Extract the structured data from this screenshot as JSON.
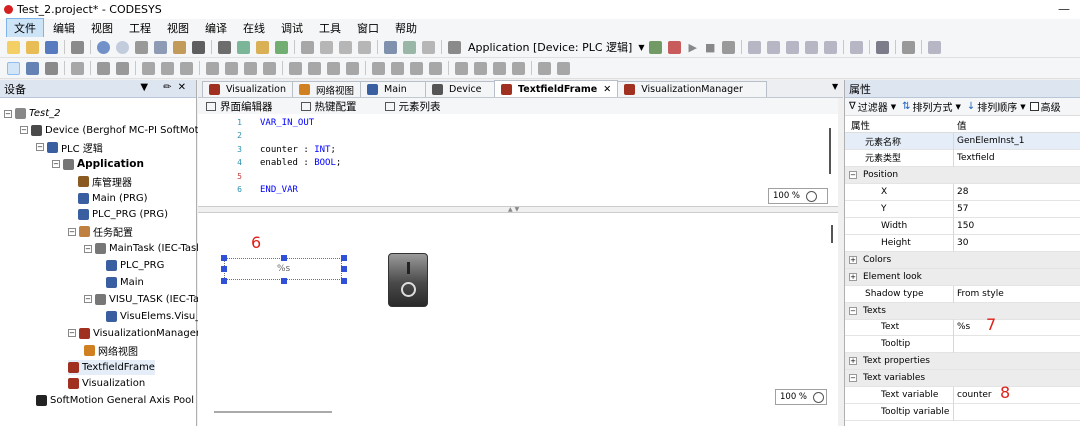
{
  "window": {
    "title": "Test_2.project* - CODESYS"
  },
  "menu": [
    "文件",
    "编辑",
    "视图",
    "工程",
    "视图",
    "编译",
    "在线",
    "调试",
    "工具",
    "窗口",
    "帮助"
  ],
  "toolbar": {
    "app_label": "Application [Device: PLC 逻辑]"
  },
  "devices_panel": {
    "title": "设备",
    "tree": [
      {
        "label": "Test_2",
        "italic": true
      },
      {
        "label": "Device (Berghof MC-PI SoftMotion Co"
      },
      {
        "label": "PLC 逻辑"
      },
      {
        "label": "Application",
        "bold": true
      },
      {
        "label": "库管理器"
      },
      {
        "label": "Main (PRG)"
      },
      {
        "label": "PLC_PRG (PRG)"
      },
      {
        "label": "任务配置"
      },
      {
        "label": "MainTask (IEC-Tasks)"
      },
      {
        "label": "PLC_PRG"
      },
      {
        "label": "Main"
      },
      {
        "label": "VISU_TASK (IEC-Task"
      },
      {
        "label": "VisuElems.Visu_P"
      },
      {
        "label": "VisualizationManager"
      },
      {
        "label": "网络视图"
      },
      {
        "label": "TextfieldFrame"
      },
      {
        "label": "Visualization"
      },
      {
        "label": "SoftMotion General Axis Pool"
      }
    ]
  },
  "editor": {
    "tabs": [
      {
        "label": "Visualization"
      },
      {
        "label": "网络视图"
      },
      {
        "label": "Main"
      },
      {
        "label": "Device"
      },
      {
        "label": "TextfieldFrame",
        "active": true
      },
      {
        "label": "VisualizationManager"
      }
    ],
    "subtabs": [
      "界面编辑器",
      "热键配置",
      "元素列表"
    ],
    "code_lines": [
      {
        "num": "1",
        "text": "VAR_IN_OUT"
      },
      {
        "num": "2",
        "text": ""
      },
      {
        "num": "3",
        "text": "counter : INT;"
      },
      {
        "num": "4",
        "text": "enabled : BOOL;"
      },
      {
        "num": "5",
        "text": ""
      },
      {
        "num": "6",
        "text": "END_VAR"
      }
    ],
    "code_zoom": "100 %",
    "vis_zoom": "100 %",
    "textfield_text": "%s",
    "annotation_6": "6"
  },
  "properties": {
    "title": "属性",
    "filter_bar": {
      "filter": "过滤器",
      "sort_by": "排列方式",
      "sort_order": "排列顺序",
      "advanced": "高级"
    },
    "header": {
      "name": "属性",
      "value": "值"
    },
    "rows": [
      {
        "name": "元素名称",
        "value": "GenElemInst_1",
        "indent": 1
      },
      {
        "name": "元素类型",
        "value": "Textfield",
        "indent": 1
      },
      {
        "name": "Position",
        "value": "",
        "cat": "minus"
      },
      {
        "name": "X",
        "value": "28",
        "indent": 2
      },
      {
        "name": "Y",
        "value": "57",
        "indent": 2
      },
      {
        "name": "Width",
        "value": "150",
        "indent": 2
      },
      {
        "name": "Height",
        "value": "30",
        "indent": 2
      },
      {
        "name": "Colors",
        "value": "",
        "cat": "plus"
      },
      {
        "name": "Element look",
        "value": "",
        "cat": "plus"
      },
      {
        "name": "Shadow type",
        "value": "From style",
        "indent": 1
      },
      {
        "name": "Texts",
        "value": "",
        "cat": "minus"
      },
      {
        "name": "Text",
        "value": "%s",
        "indent": 2
      },
      {
        "name": "Tooltip",
        "value": "",
        "indent": 2
      },
      {
        "name": "Text properties",
        "value": "",
        "cat": "plus"
      },
      {
        "name": "Text variables",
        "value": "",
        "cat": "minus"
      },
      {
        "name": "Text variable",
        "value": "counter",
        "indent": 2
      },
      {
        "name": "Tooltip variable",
        "value": "",
        "indent": 2
      }
    ],
    "annotation_7": "7",
    "annotation_8": "8"
  }
}
